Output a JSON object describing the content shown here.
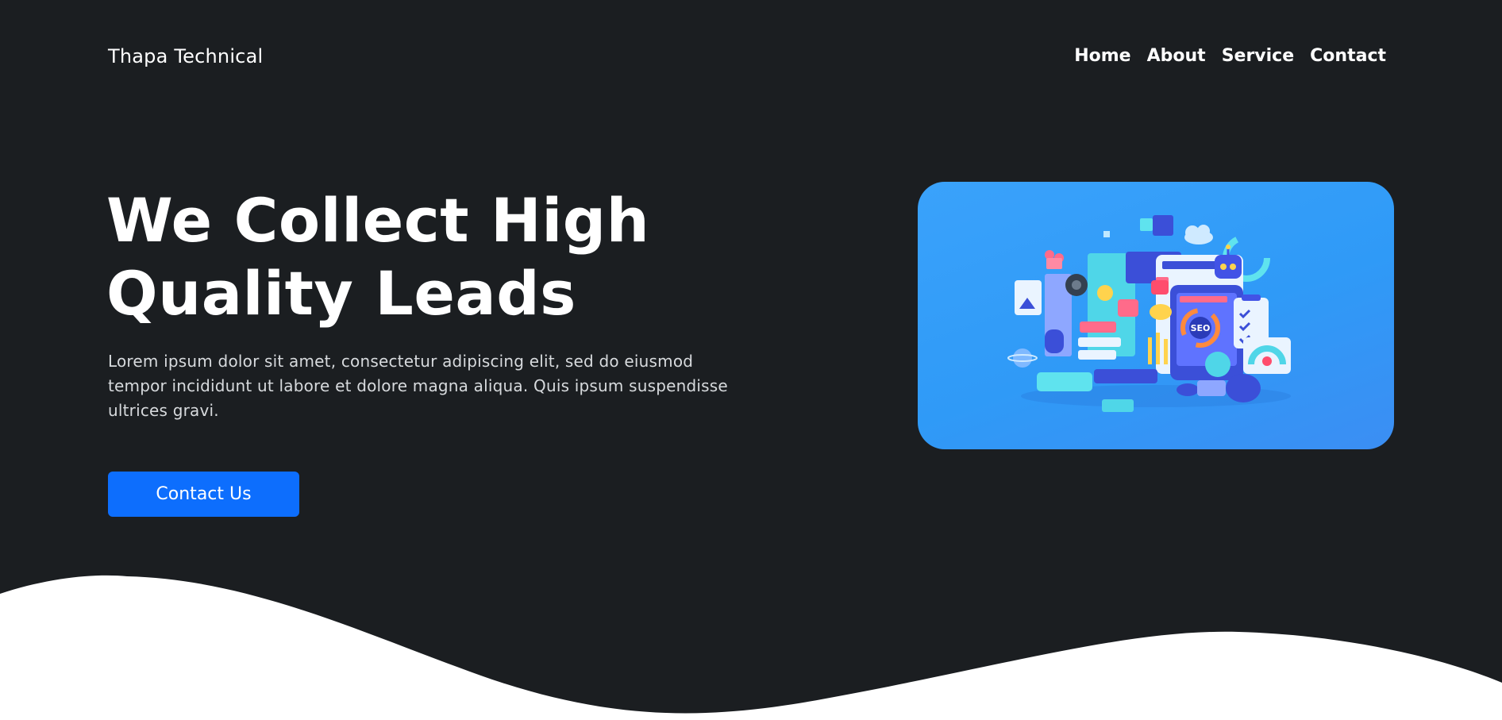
{
  "header": {
    "brand": "Thapa Technical",
    "nav": [
      {
        "label": "Home"
      },
      {
        "label": "About"
      },
      {
        "label": "Service"
      },
      {
        "label": "Contact"
      }
    ]
  },
  "hero": {
    "title_line1": "We Collect High",
    "title_line2": "Quality Leads",
    "description": "Lorem ipsum dolor sit amet, consectetur adipiscing elit, sed do eiusmod tempor incididunt ut labore et dolore magna aliqua. Quis ipsum suspendisse ultrices gravi.",
    "cta_label": "Contact Us",
    "illustration_label": "SEO"
  },
  "colors": {
    "background": "#1b1e21",
    "accent": "#0d6efd",
    "card": "#3aa2fb",
    "wave": "#ffffff"
  }
}
